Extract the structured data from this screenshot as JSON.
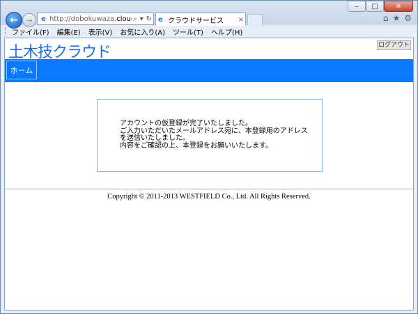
{
  "browser": {
    "url_prefix": "http://dobokuwaza.",
    "url_domain": "cloudap...",
    "tab_title": "クラウドサービス",
    "window_buttons": {
      "minimize": "–",
      "restore": "□",
      "close": "✕"
    },
    "menu": [
      "ファイル(F)",
      "編集(E)",
      "表示(V)",
      "お気に入り(A)",
      "ツール(T)",
      "ヘルプ(H)"
    ]
  },
  "site": {
    "logo": "土木技クラウド",
    "logout": "ログアウト",
    "nav": {
      "home": "ホーム"
    }
  },
  "message": {
    "lines": [
      "アカウントの仮登録が完了いたしました。",
      "ご入力いただいたメールアドレス宛に、本登録用のアドレス",
      "を送信いたしました。",
      "内容をご確認の上、本登録をお願いいたします。"
    ]
  },
  "footer": {
    "copyright": "Copyright © 2011-2013 WESTFIELD Co., Ltd. All Rights Reserved."
  }
}
